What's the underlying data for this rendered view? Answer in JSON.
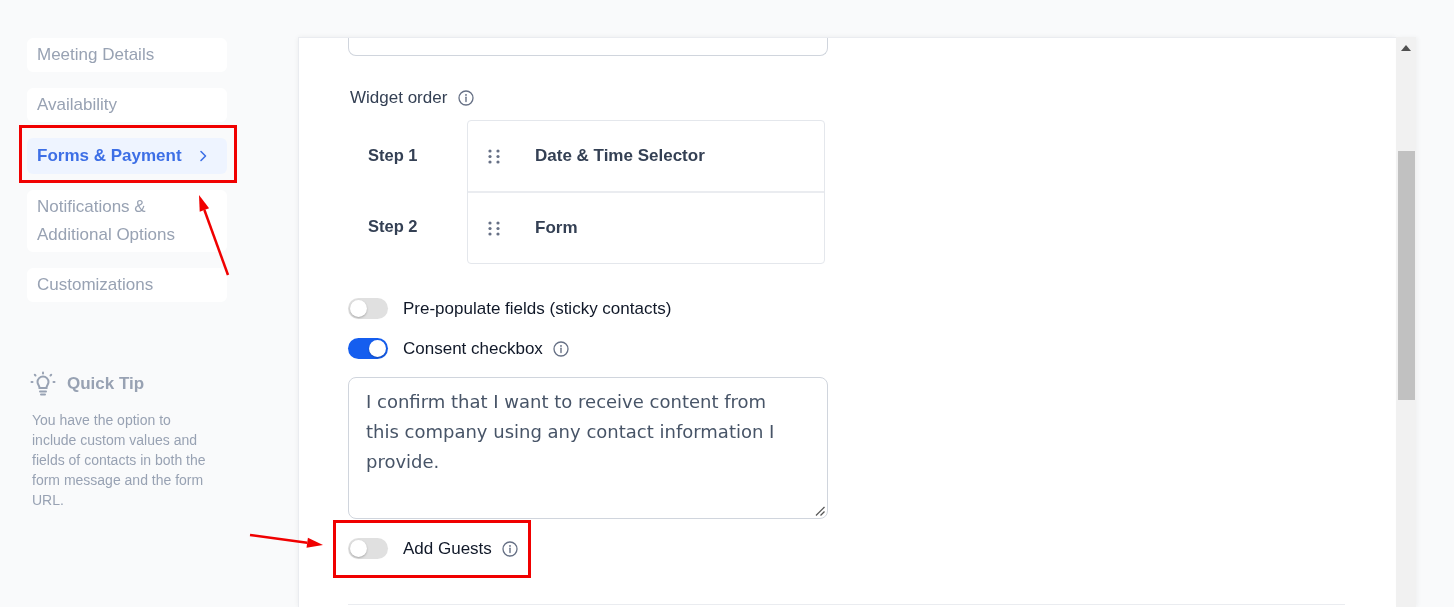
{
  "sidebar": {
    "items": [
      {
        "label": "Meeting Details",
        "selected": false,
        "highlighted": false
      },
      {
        "label": "Availability",
        "selected": false,
        "highlighted": false
      },
      {
        "label": "Forms & Payment",
        "selected": true,
        "highlighted": true
      },
      {
        "label": "Notifications & Additional Options",
        "selected": false,
        "highlighted": false
      },
      {
        "label": "Customizations",
        "selected": false,
        "highlighted": false
      }
    ]
  },
  "quick_tip": {
    "title": "Quick Tip",
    "text": "You have the option to include custom values and fields of contacts in both the form message and the form URL."
  },
  "form": {
    "widget_order": {
      "label": "Widget order",
      "info": true,
      "steps": [
        {
          "step": "Step 1",
          "widget": "Date & Time Selector"
        },
        {
          "step": "Step 2",
          "widget": "Form"
        }
      ]
    },
    "options": [
      {
        "kind": "toggle",
        "label": "Pre-populate fields (sticky contacts)",
        "on": false,
        "info": false,
        "highlighted": false
      },
      {
        "kind": "toggle",
        "label": "Consent checkbox",
        "on": true,
        "info": true,
        "highlighted": false
      },
      {
        "kind": "textarea",
        "value": "I confirm that I want to receive content from this company using any contact information I provide."
      },
      {
        "kind": "toggle",
        "label": "Add Guests",
        "on": false,
        "info": true,
        "highlighted": true
      }
    ]
  }
}
